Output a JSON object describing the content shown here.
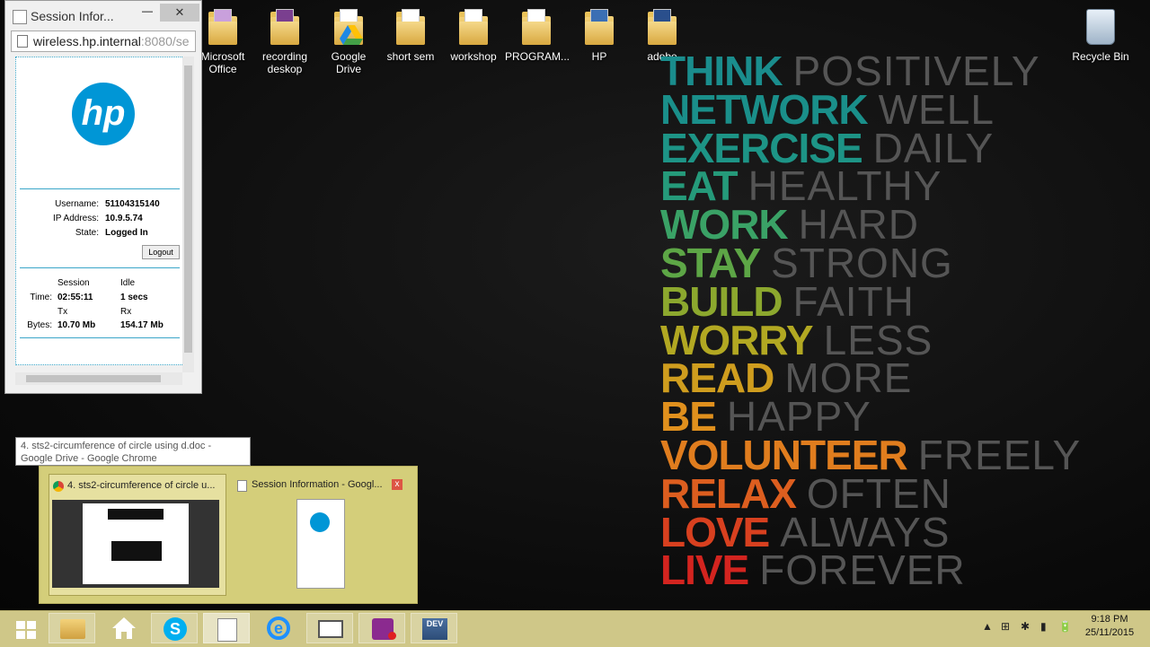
{
  "desktop_icons": [
    {
      "label": "Microsoft Office",
      "icon": "folder-icon"
    },
    {
      "label": "recording deskop",
      "icon": "folder-icon"
    },
    {
      "label": "Google Drive",
      "icon": "google-drive-folder-icon"
    },
    {
      "label": "short sem",
      "icon": "folder-icon"
    },
    {
      "label": "workshop",
      "icon": "folder-icon"
    },
    {
      "label": "PROGRAM...",
      "icon": "folder-icon"
    },
    {
      "label": "HP",
      "icon": "folder-icon"
    },
    {
      "label": "adobe",
      "icon": "folder-icon"
    },
    {
      "label": "Recycle Bin",
      "icon": "recycle-bin-icon"
    }
  ],
  "wallpaper": {
    "lines": [
      {
        "bold": "THINK",
        "light": "POSITIVELY",
        "color": "#1a8d8d"
      },
      {
        "bold": "NETWORK",
        "light": "WELL",
        "color": "#1a8f8a"
      },
      {
        "bold": "EXERCISE",
        "light": "DAILY",
        "color": "#1d9486"
      },
      {
        "bold": "EAT",
        "light": "HEALTHY",
        "color": "#259a7a"
      },
      {
        "bold": "WORK",
        "light": "HARD",
        "color": "#3aa266"
      },
      {
        "bold": "STAY",
        "light": "STRONG",
        "color": "#5da646"
      },
      {
        "bold": "BUILD",
        "light": "FAITH",
        "color": "#8ca82e"
      },
      {
        "bold": "WORRY",
        "light": "LESS",
        "color": "#b2a822"
      },
      {
        "bold": "READ",
        "light": "MORE",
        "color": "#cf9d1e"
      },
      {
        "bold": "BE",
        "light": "HAPPY",
        "color": "#e0901d"
      },
      {
        "bold": "VOLUNTEER",
        "light": "FREELY",
        "color": "#e07d1e"
      },
      {
        "bold": "RELAX",
        "light": "OFTEN",
        "color": "#dd5e1f"
      },
      {
        "bold": "LOVE",
        "light": "ALWAYS",
        "color": "#d8401f"
      },
      {
        "bold": "LIVE",
        "light": "FOREVER",
        "color": "#d3241f"
      }
    ]
  },
  "popup": {
    "title": "Session Infor...",
    "minimize": "—",
    "close": "✕",
    "url_host": "wireless.hp.internal",
    "url_rest": ":8080/se",
    "logo": "hp",
    "username_label": "Username:",
    "username": "51104315140",
    "ip_label": "IP Address:",
    "ip": "10.9.5.74",
    "state_label": "State:",
    "state": "Logged In",
    "logout": "Logout",
    "session_header": "Session",
    "idle_header": "Idle",
    "time_label": "Time:",
    "session_time": "02:55:11",
    "idle_time": "1 secs",
    "tx_header": "Tx",
    "rx_header": "Rx",
    "bytes_label": "Bytes:",
    "tx_bytes": "10.70 Mb",
    "rx_bytes": "154.17 Mb"
  },
  "tooltip": "4. sts2-circumference of circle using d.doc - Google Drive - Google Chrome",
  "thumbnails": [
    {
      "label": "4. sts2-circumference of circle u...",
      "icon": "chrome-icon"
    },
    {
      "label": "Session Information - Googl...",
      "icon": "document-icon",
      "close": "x"
    }
  ],
  "taskbar": {
    "items": [
      "start-icon",
      "file-explorer-icon",
      "home-icon",
      "skype-icon",
      "document-icon",
      "internet-explorer-icon",
      "window-icon",
      "media-icon",
      "dev-icon"
    ],
    "tray": [
      "▲",
      "⊞",
      "✱",
      "▮",
      "🔋"
    ],
    "time": "9:18 PM",
    "date": "25/11/2015"
  }
}
